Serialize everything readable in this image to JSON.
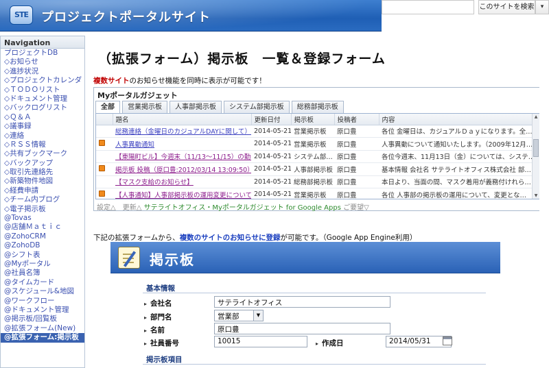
{
  "header": {
    "logo_text": "STE",
    "site_title": "プロジェクトポータルサイト",
    "search_scope": "このサイトを検索",
    "search_dropdown_glyph": "▾"
  },
  "nav": {
    "heading": "Navigation",
    "items": [
      {
        "label": "プロジェクトDB"
      },
      {
        "label": "◇お知らせ"
      },
      {
        "label": "◇進捗状況"
      },
      {
        "label": "◇プロジェクトカレンダ"
      },
      {
        "label": "◇ＴＯＤＯリスト"
      },
      {
        "label": "◇ドキュメント管理"
      },
      {
        "label": "◇バックログリスト"
      },
      {
        "label": "◇Ｑ＆Ａ"
      },
      {
        "label": "◇議事録"
      },
      {
        "label": "◇連絡"
      },
      {
        "label": "◇ＲＳＳ情報"
      },
      {
        "label": "◇共有ブックマーク"
      },
      {
        "label": "◇バックアップ"
      },
      {
        "label": "◇取引先連絡先"
      },
      {
        "label": "◇新築物件地図"
      },
      {
        "label": "◇経費申請"
      },
      {
        "label": "◇チーム内ブログ"
      },
      {
        "label": "◇電子掲示板"
      },
      {
        "label": "@Tovas"
      },
      {
        "label": "@店舗Ｍａｔｉｃ"
      },
      {
        "label": "@ZohoCRM"
      },
      {
        "label": "@ZohoDB"
      },
      {
        "label": "@シフト表"
      },
      {
        "label": "@Myポータル"
      },
      {
        "label": "@社員名簿"
      },
      {
        "label": "@タイムカード"
      },
      {
        "label": "@スケジュール&地図"
      },
      {
        "label": "@ワークフロー"
      },
      {
        "label": "@ドキュメント管理"
      },
      {
        "label": "@掲示板/回覧板"
      },
      {
        "label": "@拡張フォーム(New)"
      },
      {
        "label": "@拡張フォーム:掲示板",
        "active": true
      }
    ]
  },
  "main": {
    "title": "（拡張フォーム）掲示板　一覧＆登録フォーム",
    "intro_highlight": "複数サイト",
    "intro_rest": "のお知らせ機能を同時に表示が可能です！",
    "lead_before": "下記の拡張フォームから、",
    "lead_highlight": "複数のサイトのお知らせに登録",
    "lead_after": "が可能です。（Google App Engine利用）"
  },
  "gadget": {
    "title": "Myポータルガジェット",
    "tabs": [
      "全部",
      "営業掲示板",
      "人事部掲示板",
      "システム部掲示板",
      "総務部掲示板"
    ],
    "columns": [
      "",
      "題名",
      "更新日付",
      "掲示板",
      "投稿者",
      "内容"
    ],
    "rows": [
      {
        "icon": false,
        "title": "総務連絡（金曜日のカジュアルDAYに関して）",
        "date": "2014-05-21",
        "board": "営業掲示板",
        "author": "原口豊",
        "content": "各位 金曜日は、カジュアルＤａｙになります。全…"
      },
      {
        "icon": true,
        "title": "人事異動通知",
        "date": "2014-05-21",
        "board": "営業掲示板",
        "author": "原口豊",
        "content": "人事異動について通知いたします。（2009年12月…"
      },
      {
        "icon": false,
        "title": "【東陽町ビル】今週末（11/13～11/15）の勤務",
        "date": "2014-05-21",
        "board": "システム部…",
        "author": "原口豊",
        "content": "各位今週末、11月13日（金）については、システ…"
      },
      {
        "icon": true,
        "title": "掲示板 投稿（原口豊:2012/03/14 13:09:50）",
        "date": "2014-05-21",
        "board": "人事部掲示板",
        "author": "原口豊",
        "content": "基本情報 会社名 サテライトオフィス株式会社 部…"
      },
      {
        "icon": false,
        "title": "【マスク支給のお知らせ】",
        "date": "2014-05-21",
        "board": "総務部掲示板",
        "author": "原口豊",
        "content": "本日より、当面の間、マスク着用が義務付けれら…"
      },
      {
        "icon": true,
        "title": "【人事通知】人事部掲示板の運用変更について",
        "date": "2014-05-21",
        "board": "営業掲示板",
        "author": "原口豊",
        "content": "各位 人事部の掲示板の運用について、変更とな…"
      }
    ],
    "footer_left": "設定△　更新△",
    "footer_mid": "サテライトオフィス・Myポータルガジェット for Google Apps",
    "footer_right": "ご要望▽"
  },
  "form": {
    "title": "掲示板",
    "section_basic": "基本情報",
    "company_label": "会社名",
    "company_value": "サテライトオフィス",
    "dept_label": "部門名",
    "dept_value": "営業部",
    "name_label": "名前",
    "name_value": "原口豊",
    "empno_label": "社員番号",
    "empno_value": "10015",
    "created_label": "作成日",
    "created_value": "2014/05/31",
    "section_items": "掲示板項目"
  }
}
